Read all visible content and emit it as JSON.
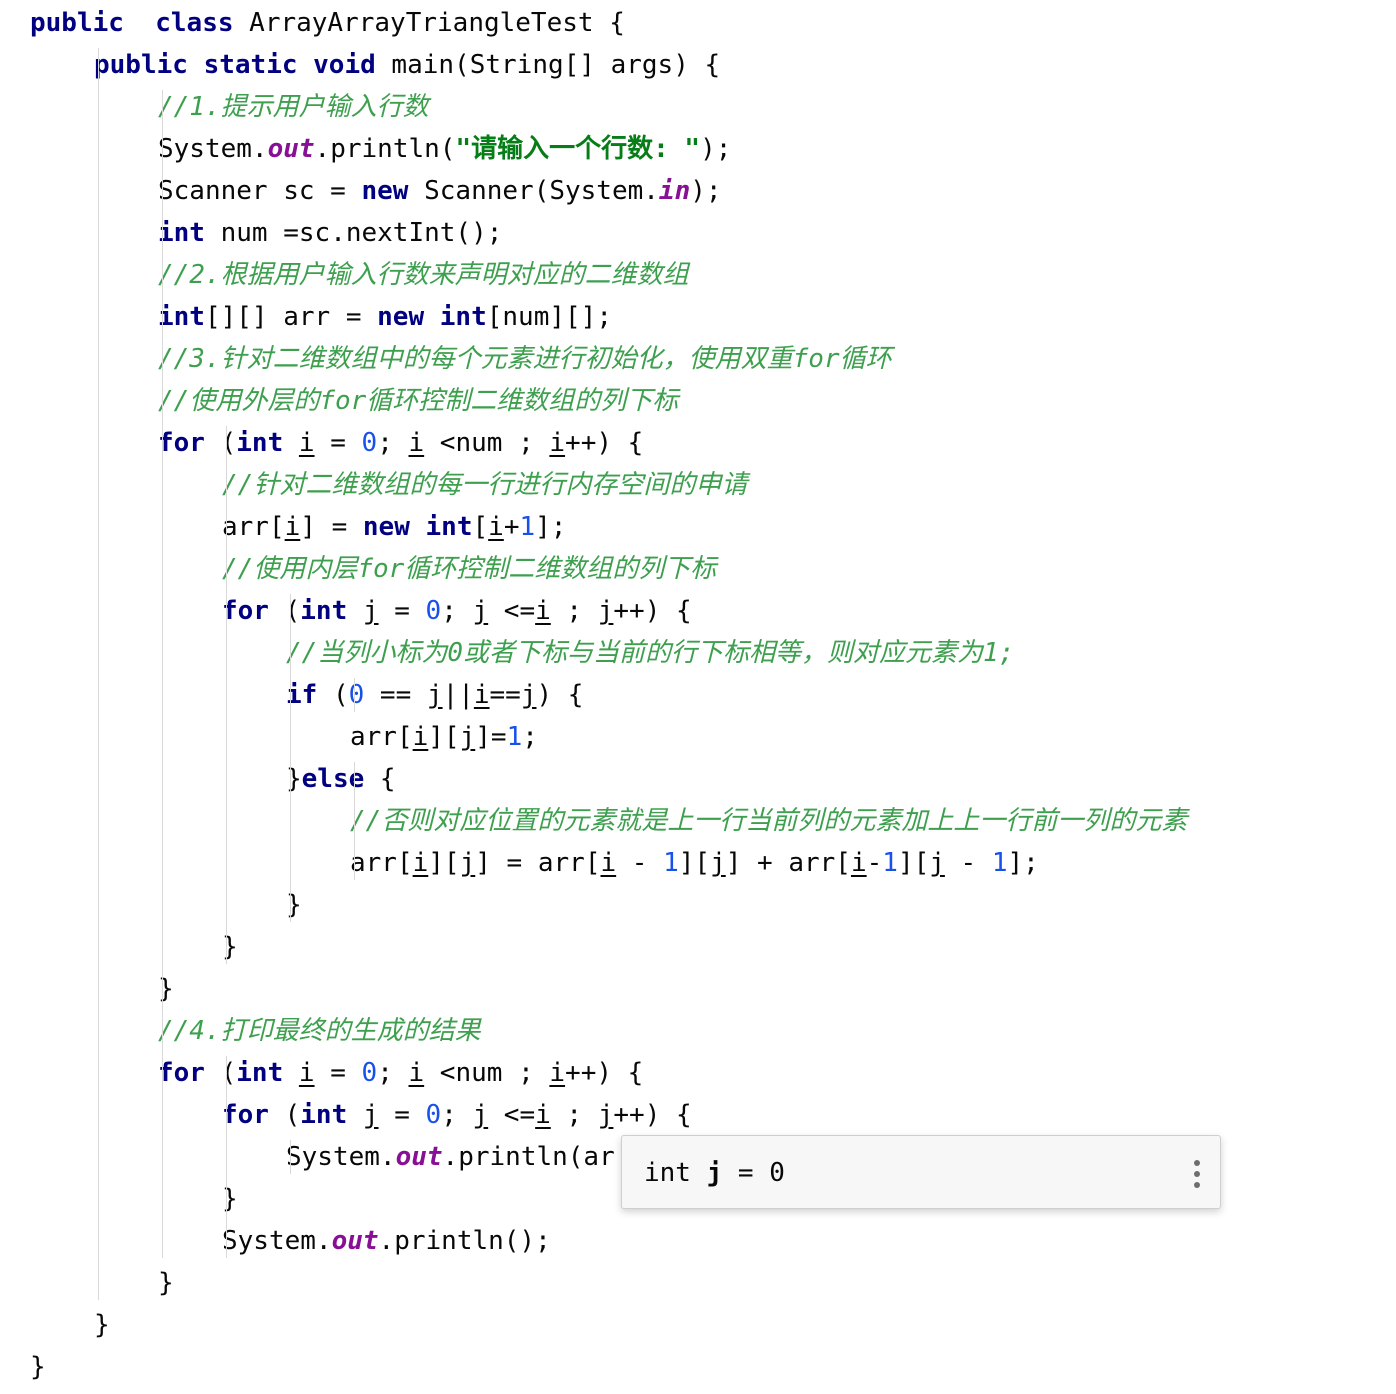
{
  "editor": {
    "language": "java",
    "lines": [
      {
        "indent": 0,
        "tokens": [
          [
            "kw dark",
            "public"
          ],
          [
            "",
            "  "
          ],
          [
            "kw dark",
            "class"
          ],
          [
            "",
            " ArrayArrayTriangleTest {"
          ]
        ]
      },
      {
        "indent": 1,
        "tokens": [
          [
            "kw dark",
            "public"
          ],
          [
            "",
            " "
          ],
          [
            "kw dark",
            "static"
          ],
          [
            "",
            " "
          ],
          [
            "kw dark",
            "void"
          ],
          [
            "",
            " main(String[] args) {"
          ]
        ]
      },
      {
        "indent": 2,
        "tokens": [
          [
            "cmt",
            "//1."
          ],
          [
            "cmt cjk",
            "提示用户输入行数"
          ]
        ]
      },
      {
        "indent": 2,
        "tokens": [
          [
            "",
            "System."
          ],
          [
            "fld",
            "out"
          ],
          [
            "",
            ".println("
          ],
          [
            "str",
            "\"请输入一个行数: \""
          ],
          [
            "",
            ");"
          ]
        ]
      },
      {
        "indent": 2,
        "tokens": [
          [
            "",
            "Scanner sc = "
          ],
          [
            "kw dark",
            "new"
          ],
          [
            "",
            " Scanner(System."
          ],
          [
            "fld",
            "in"
          ],
          [
            "",
            ");"
          ]
        ]
      },
      {
        "indent": 2,
        "tokens": [
          [
            "kw dark",
            "int"
          ],
          [
            "",
            " num =sc.nextInt();"
          ]
        ]
      },
      {
        "indent": 2,
        "tokens": [
          [
            "cmt",
            "//2."
          ],
          [
            "cmt cjk",
            "根据用户输入行数来声明对应的二维数组"
          ]
        ]
      },
      {
        "indent": 2,
        "tokens": [
          [
            "kw dark",
            "int"
          ],
          [
            "",
            "[][] arr = "
          ],
          [
            "kw dark",
            "new"
          ],
          [
            "",
            " "
          ],
          [
            "kw dark",
            "int"
          ],
          [
            "",
            "[num][];"
          ]
        ]
      },
      {
        "indent": 2,
        "tokens": [
          [
            "cmt",
            "//3."
          ],
          [
            "cmt cjk",
            "针对二维数组中的每个元素进行初始化，使用双重"
          ],
          [
            "cmt",
            "for"
          ],
          [
            "cmt cjk",
            "循环"
          ]
        ]
      },
      {
        "indent": 2,
        "tokens": [
          [
            "cmt",
            "//"
          ],
          [
            "cmt cjk",
            "使用外层的"
          ],
          [
            "cmt",
            "for"
          ],
          [
            "cmt cjk",
            "循环控制二维数组的列下标"
          ]
        ]
      },
      {
        "indent": 2,
        "tokens": [
          [
            "kw dark",
            "for"
          ],
          [
            "",
            " ("
          ],
          [
            "kw dark",
            "int"
          ],
          [
            "",
            " "
          ],
          [
            "ul",
            "i"
          ],
          [
            "",
            " = "
          ],
          [
            "num",
            "0"
          ],
          [
            "",
            "; "
          ],
          [
            "ul",
            "i"
          ],
          [
            "",
            " <num ; "
          ],
          [
            "ul",
            "i"
          ],
          [
            "",
            "++) {"
          ]
        ]
      },
      {
        "indent": 3,
        "tokens": [
          [
            "cmt",
            "//"
          ],
          [
            "cmt cjk",
            "针对二维数组的每一行进行内存空间的申请"
          ]
        ]
      },
      {
        "indent": 3,
        "tokens": [
          [
            "",
            "arr["
          ],
          [
            "ul",
            "i"
          ],
          [
            "",
            "] = "
          ],
          [
            "kw dark",
            "new"
          ],
          [
            "",
            " "
          ],
          [
            "kw dark",
            "int"
          ],
          [
            "",
            "["
          ],
          [
            "ul",
            "i"
          ],
          [
            "",
            "+"
          ],
          [
            "num",
            "1"
          ],
          [
            "",
            "];"
          ]
        ]
      },
      {
        "indent": 3,
        "tokens": [
          [
            "cmt",
            "//"
          ],
          [
            "cmt cjk",
            "使用内层"
          ],
          [
            "cmt",
            "for"
          ],
          [
            "cmt cjk",
            "循环控制二维数组的列下标"
          ]
        ]
      },
      {
        "indent": 3,
        "tokens": [
          [
            "kw dark",
            "for"
          ],
          [
            "",
            " ("
          ],
          [
            "kw dark",
            "int"
          ],
          [
            "",
            " "
          ],
          [
            "ul",
            "j"
          ],
          [
            "",
            " = "
          ],
          [
            "num",
            "0"
          ],
          [
            "",
            "; "
          ],
          [
            "ul",
            "j"
          ],
          [
            "",
            " <="
          ],
          [
            "ul",
            "i"
          ],
          [
            "",
            " ; "
          ],
          [
            "ul",
            "j"
          ],
          [
            "",
            "++) {"
          ]
        ]
      },
      {
        "indent": 4,
        "tokens": [
          [
            "cmt",
            "//"
          ],
          [
            "cmt cjk",
            "当列小标为"
          ],
          [
            "cmt",
            "0"
          ],
          [
            "cmt cjk",
            "或者下标与当前的行下标相等，则对应元素为"
          ],
          [
            "cmt",
            "1;"
          ]
        ]
      },
      {
        "indent": 4,
        "tokens": [
          [
            "kw dark",
            "if"
          ],
          [
            "",
            " ("
          ],
          [
            "num",
            "0"
          ],
          [
            "",
            " == "
          ],
          [
            "ul",
            "j"
          ],
          [
            "",
            "||"
          ],
          [
            "ul",
            "i"
          ],
          [
            "",
            "=="
          ],
          [
            "ul",
            "j"
          ],
          [
            "",
            ") {"
          ]
        ]
      },
      {
        "indent": 5,
        "tokens": [
          [
            "",
            "arr["
          ],
          [
            "ul",
            "i"
          ],
          [
            "",
            "]["
          ],
          [
            "ul",
            "j"
          ],
          [
            "",
            "]="
          ],
          [
            "num",
            "1"
          ],
          [
            "",
            ";"
          ]
        ]
      },
      {
        "indent": 4,
        "tokens": [
          [
            "",
            "}"
          ],
          [
            "kw dark",
            "else"
          ],
          [
            "",
            " {"
          ]
        ]
      },
      {
        "indent": 5,
        "tokens": [
          [
            "cmt",
            "//"
          ],
          [
            "cmt cjk",
            "否则对应位置的元素就是上一行当前列的元素加上上一行前一列的元素"
          ]
        ]
      },
      {
        "indent": 5,
        "tokens": [
          [
            "",
            "arr["
          ],
          [
            "ul",
            "i"
          ],
          [
            "",
            "]["
          ],
          [
            "ul",
            "j"
          ],
          [
            "",
            "] = arr["
          ],
          [
            "ul",
            "i"
          ],
          [
            "",
            " - "
          ],
          [
            "num",
            "1"
          ],
          [
            "",
            "]["
          ],
          [
            "ul",
            "j"
          ],
          [
            "",
            "] + arr["
          ],
          [
            "ul",
            "i"
          ],
          [
            "",
            "-"
          ],
          [
            "num",
            "1"
          ],
          [
            "",
            "]["
          ],
          [
            "ul",
            "j"
          ],
          [
            "",
            " - "
          ],
          [
            "num",
            "1"
          ],
          [
            "",
            "];"
          ]
        ]
      },
      {
        "indent": 4,
        "tokens": [
          [
            "",
            "}"
          ]
        ]
      },
      {
        "indent": 3,
        "tokens": [
          [
            "",
            "}"
          ]
        ]
      },
      {
        "indent": 2,
        "tokens": [
          [
            "",
            "}"
          ]
        ]
      },
      {
        "indent": 2,
        "tokens": [
          [
            "cmt",
            "//4."
          ],
          [
            "cmt cjk",
            "打印最终的生成的结果"
          ]
        ]
      },
      {
        "indent": 2,
        "tokens": [
          [
            "kw dark",
            "for"
          ],
          [
            "",
            " ("
          ],
          [
            "kw dark",
            "int"
          ],
          [
            "",
            " "
          ],
          [
            "ul",
            "i"
          ],
          [
            "",
            " = "
          ],
          [
            "num",
            "0"
          ],
          [
            "",
            "; "
          ],
          [
            "ul",
            "i"
          ],
          [
            "",
            " <num ; "
          ],
          [
            "ul",
            "i"
          ],
          [
            "",
            "++) {"
          ]
        ]
      },
      {
        "indent": 3,
        "tokens": [
          [
            "kw dark",
            "for"
          ],
          [
            "",
            " ("
          ],
          [
            "kw dark",
            "int"
          ],
          [
            "",
            " "
          ],
          [
            "ul",
            "j"
          ],
          [
            "",
            " = "
          ],
          [
            "num",
            "0"
          ],
          [
            "",
            "; "
          ],
          [
            "ul",
            "j"
          ],
          [
            "",
            " <="
          ],
          [
            "ul",
            "i"
          ],
          [
            "",
            " ; "
          ],
          [
            "ul",
            "j"
          ],
          [
            "",
            "++) {"
          ]
        ]
      },
      {
        "indent": 4,
        "tokens": [
          [
            "",
            "System."
          ],
          [
            "fld",
            "out"
          ],
          [
            "",
            ".println(ar"
          ]
        ]
      },
      {
        "indent": 3,
        "tokens": [
          [
            "",
            "}"
          ]
        ]
      },
      {
        "indent": 3,
        "tokens": [
          [
            "",
            "System."
          ],
          [
            "fld",
            "out"
          ],
          [
            "",
            ".println();"
          ]
        ]
      },
      {
        "indent": 2,
        "tokens": [
          [
            "",
            "}"
          ]
        ]
      },
      {
        "indent": 1,
        "tokens": [
          [
            "",
            "}"
          ]
        ]
      },
      {
        "indent": 0,
        "tokens": [
          [
            "",
            "}"
          ]
        ]
      }
    ]
  },
  "tooltip": {
    "text": "int j = 0",
    "prefix": "int ",
    "name": "j",
    "suffix": " = 0",
    "more_icon": "vertical-ellipsis-icon"
  },
  "colors": {
    "keyword": "#000080",
    "comment": "#3ea04f",
    "string": "#067d17",
    "number": "#1750eb",
    "static_field": "#871094",
    "guide": "#d9d9d9",
    "tooltip_bg": "#f7f7f7"
  }
}
